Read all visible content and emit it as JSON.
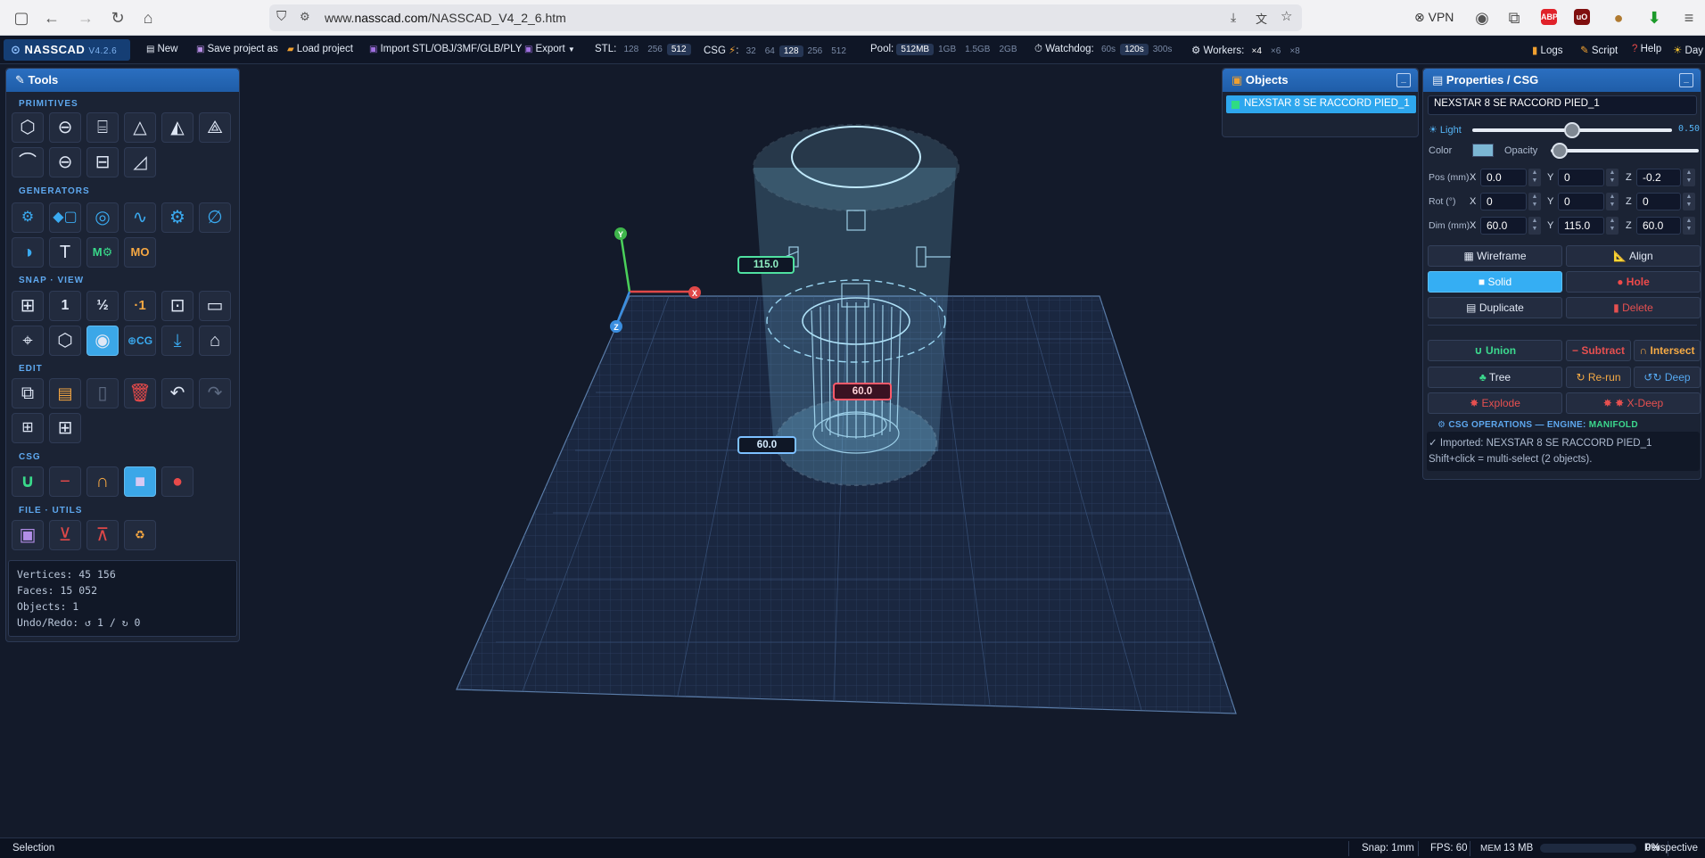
{
  "browser": {
    "url_prefix": "www.",
    "url_domain": "nasscad.com",
    "url_path": "/NASSCAD_V4_2_6.htm",
    "vpn_label": "VPN",
    "ext_abp": "ABP",
    "ext_ub": "uO"
  },
  "app": {
    "name": "NASSCAD",
    "version": "V4.2.6",
    "toolbar": {
      "new": "New",
      "save": "Save project as",
      "load": "Load project",
      "import": "Import STL/OBJ/3MF/GLB/PLY",
      "export": "Export",
      "stl_label": "STL:",
      "stl_options": [
        "128",
        "256",
        "512"
      ],
      "stl_selected": "512",
      "csg_label": "CSG",
      "csg_options": [
        "32",
        "64",
        "128",
        "256",
        "512"
      ],
      "csg_selected": "128",
      "pool_label": "Pool:",
      "pool_options": [
        "512MB",
        "1GB",
        "1.5GB",
        "2GB"
      ],
      "pool_selected": "512MB",
      "watchdog_label": "Watchdog:",
      "watchdog_options": [
        "60s",
        "120s",
        "300s"
      ],
      "watchdog_selected": "120s",
      "workers_label": "Workers:",
      "workers_options": [
        "×4",
        "×6",
        "×8"
      ],
      "workers_selected": "×4",
      "logs": "Logs",
      "script": "Script",
      "help": "Help",
      "theme": "Day"
    }
  },
  "tools_panel": {
    "title": "Tools",
    "sections": {
      "primitives": "PRIMITIVES",
      "generators": "GENERATORS",
      "snap_view": "SNAP · VIEW",
      "edit": "EDIT",
      "csg": "CSG",
      "file_utils": "FILE · UTILS"
    },
    "gen_labels": {
      "text": "T",
      "mo_gear": "M⚙",
      "mo": "MO"
    },
    "snap_labels": {
      "one": "1",
      "half": "½",
      "tenth": "·1",
      "cg": "⊕CG"
    },
    "stats": {
      "vertices": "Vertices: 45 156",
      "faces": "Faces: 15 052",
      "objects": "Objects: 1",
      "undo": "Undo/Redo: ↺ 1 / ↻ 0"
    }
  },
  "objects_panel": {
    "title": "Objects",
    "items": [
      {
        "label": "NEXSTAR 8 SE RACCORD PIED_1"
      }
    ]
  },
  "properties_panel": {
    "title": "Properties / CSG",
    "name": "NEXSTAR 8 SE RACCORD PIED_1",
    "light_label": "☀ Light",
    "light_value": 0.5,
    "light_display": "0.50",
    "color_label": "Color",
    "color_hex": "#7cb7d4",
    "opacity_label": "Opacity",
    "opacity_value": 0.02,
    "pos_label": "Pos (mm)",
    "rot_label": "Rot (°)",
    "dim_label": "Dim (mm)",
    "axis_x": "X",
    "axis_y": "Y",
    "axis_z": "Z",
    "pos": {
      "x": "0.0",
      "y": "0",
      "z": "-0.2"
    },
    "rot": {
      "x": "0",
      "y": "0",
      "z": "0"
    },
    "dim": {
      "x": "60.0",
      "y": "115.0",
      "z": "60.0"
    },
    "buttons": {
      "wireframe": "Wireframe",
      "align": "Align",
      "solid": "Solid",
      "hole": "Hole",
      "duplicate": "Duplicate",
      "delete": "Delete",
      "union": "∪ Union",
      "subtract": "− Subtract",
      "intersect": "∩ Intersect",
      "tree": "Tree",
      "rerun": "↻ Re-run",
      "deep": "↺↻ Deep",
      "explode": "Explode",
      "xdeep": "X-Deep"
    },
    "csg_ops_title": "⚙ CSG OPERATIONS — ENGINE: ",
    "csg_engine": "MANIFOLD",
    "log_lines": [
      "✓ Imported: NEXSTAR 8 SE RACCORD PIED_1",
      "Shift+click = multi-select (2 objects)."
    ]
  },
  "viewport": {
    "dim_height": "115.0",
    "dim_width": "60.0",
    "dim_depth": "60.0",
    "axis_y": "Y",
    "axis_x": "X",
    "axis_z": "Z",
    "colors": {
      "height": "#4fe0a0",
      "width": "#ff5a6a",
      "depth": "#7cc0ff"
    }
  },
  "status": {
    "mode": "Selection",
    "snap": "Snap: 1mm",
    "fps": "FPS: 60",
    "mem_label": "MEM",
    "mem": "13 MB",
    "mem_pct": "0%",
    "mem_fraction": 0.0,
    "projection": "Perspective"
  }
}
